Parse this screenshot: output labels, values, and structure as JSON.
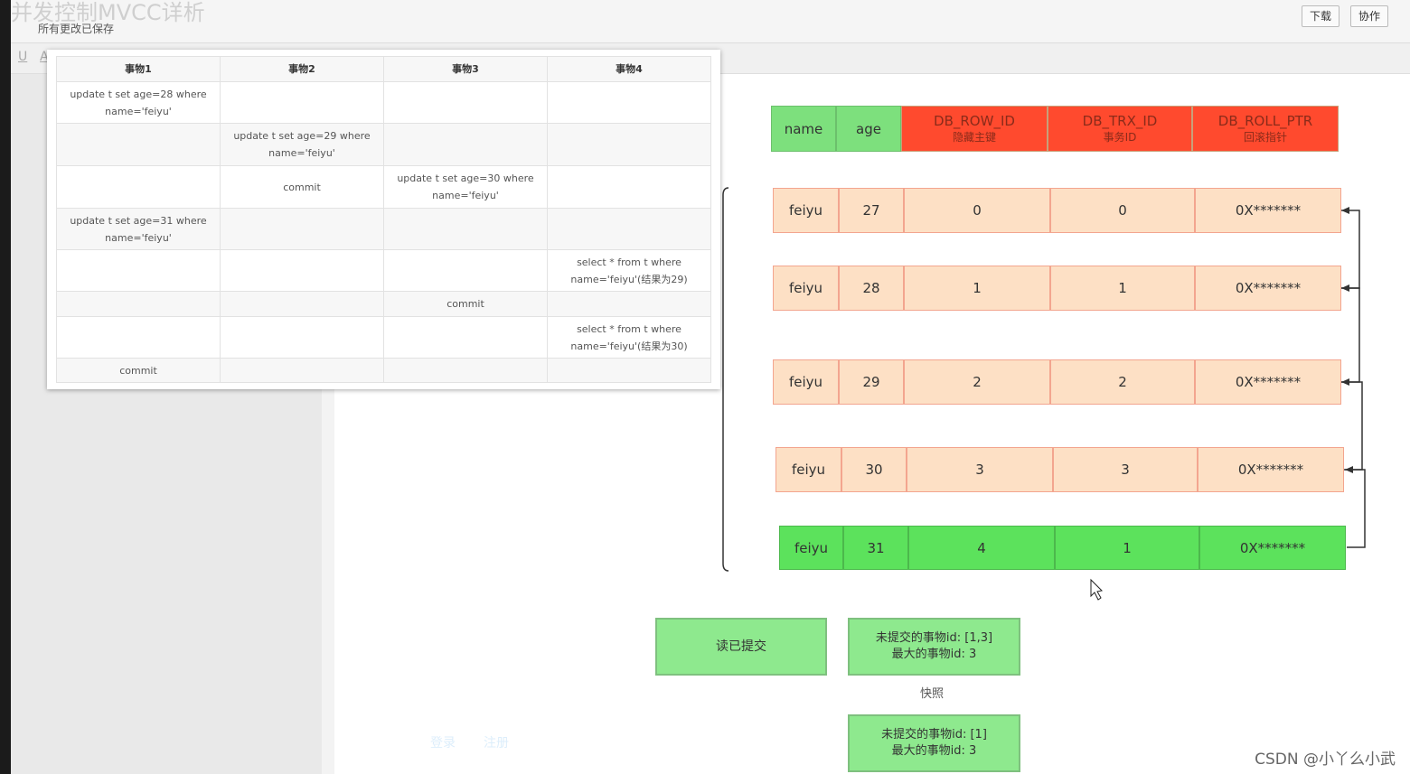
{
  "app": {
    "title": "并发控制MVCC详析",
    "save_status": "所有更改已保存",
    "download_label": "下载",
    "collaborate_label": "协作"
  },
  "toolbar": {
    "underline_glyph": "U",
    "font_glyph": "A"
  },
  "popup": {
    "headers": [
      "事物1",
      "事物2",
      "事物3",
      "事物4"
    ],
    "rows": [
      [
        "update t set age=28 where name='feiyu'",
        "",
        "",
        ""
      ],
      [
        "",
        "update t set age=29 where name='feiyu'",
        "",
        ""
      ],
      [
        "",
        "commit",
        "update t set age=30 where name='feiyu'",
        ""
      ],
      [
        "update t set age=31 where name='feiyu'",
        "",
        "",
        ""
      ],
      [
        "",
        "",
        "",
        "select * from t where name='feiyu'(结果为29)"
      ],
      [
        "",
        "",
        "commit",
        ""
      ],
      [
        "",
        "",
        "",
        "select * from t where name='feiyu'(结果为30)"
      ],
      [
        "commit",
        "",
        "",
        ""
      ]
    ]
  },
  "diagram": {
    "header": {
      "name": "name",
      "age": "age",
      "row_id": "DB_ROW_ID",
      "row_id_sub": "隐藏主键",
      "trx_id": "DB_TRX_ID",
      "trx_id_sub": "事务ID",
      "roll_ptr": "DB_ROLL_PTR",
      "roll_ptr_sub": "回滚指针"
    },
    "versions": [
      {
        "name": "feiyu",
        "age": "27",
        "row_id": "0",
        "trx_id": "0",
        "roll_ptr": "0X*******"
      },
      {
        "name": "feiyu",
        "age": "28",
        "row_id": "1",
        "trx_id": "1",
        "roll_ptr": "0X*******"
      },
      {
        "name": "feiyu",
        "age": "29",
        "row_id": "2",
        "trx_id": "2",
        "roll_ptr": "0X*******"
      },
      {
        "name": "feiyu",
        "age": "30",
        "row_id": "3",
        "trx_id": "3",
        "roll_ptr": "0X*******"
      },
      {
        "name": "feiyu",
        "age": "31",
        "row_id": "4",
        "trx_id": "1",
        "roll_ptr": "0X*******"
      }
    ],
    "isolation_label": "读已提交",
    "snapshot1_line1": "未提交的事物id: [1,3]",
    "snapshot1_line2": "最大的事物id: 3",
    "snapshot_label": "快照",
    "snapshot2_line1": "未提交的事物id: [1]",
    "snapshot2_line2": "最大的事物id: 3"
  },
  "colors": {
    "header_green": "#7de07d",
    "header_red": "#ff4a2e",
    "version_peach": "#fde0c5",
    "current_green": "#5ce25c",
    "flow_green": "#8ee98e"
  },
  "footer": {
    "login": "登录",
    "register": "注册"
  },
  "watermark": "CSDN @小丫么小武"
}
